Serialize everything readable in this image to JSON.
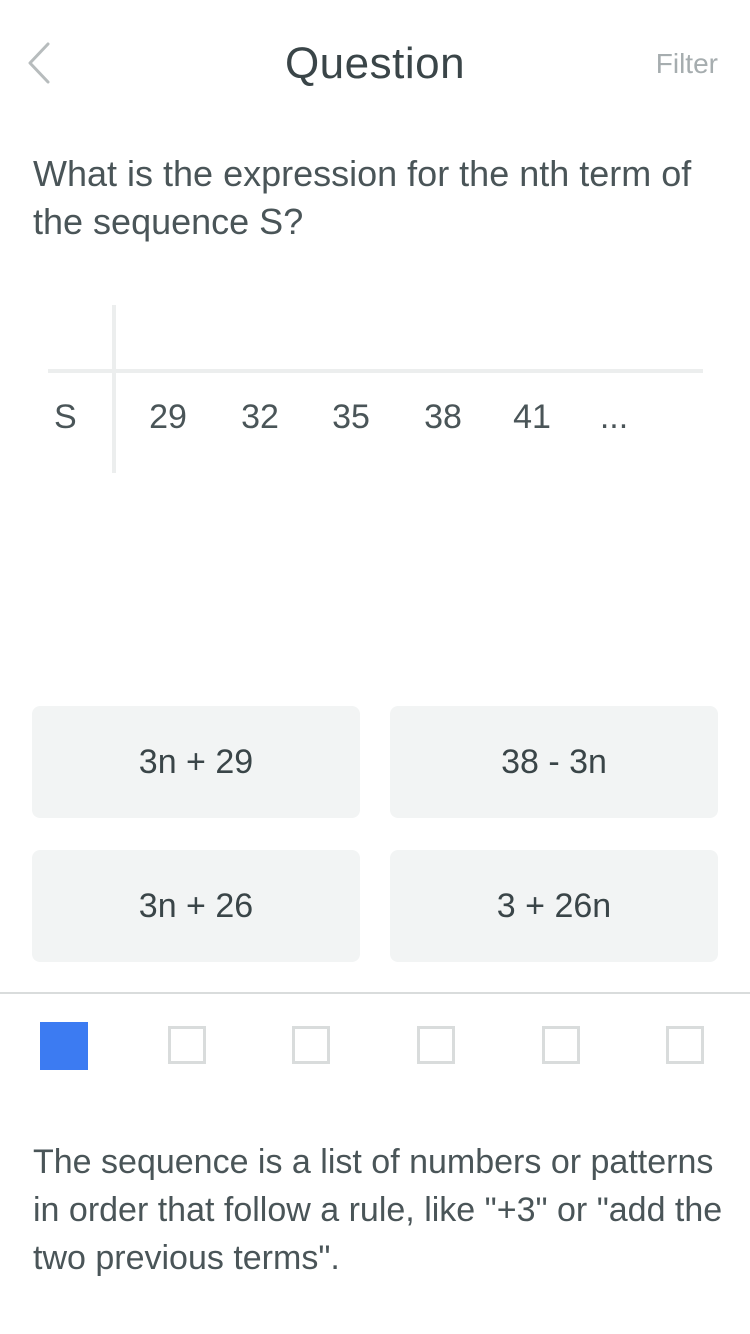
{
  "header": {
    "title": "Question",
    "filter_label": "Filter"
  },
  "question": {
    "text": "What is the expression for the nth term of the sequence S?"
  },
  "sequence": {
    "label": "S",
    "terms": [
      "29",
      "32",
      "35",
      "38",
      "41",
      "..."
    ]
  },
  "answers": [
    {
      "label": "3n + 29"
    },
    {
      "label": "38 - 3n"
    },
    {
      "label": "3n + 26"
    },
    {
      "label": "3 + 26n"
    }
  ],
  "progress": {
    "current": 1,
    "total": 6,
    "active_color": "#3c7bf2"
  },
  "hint": {
    "text": "The sequence is a list of numbers or patterns in order that follow a rule, like \"+3\" or \"add the two previous terms\"."
  }
}
